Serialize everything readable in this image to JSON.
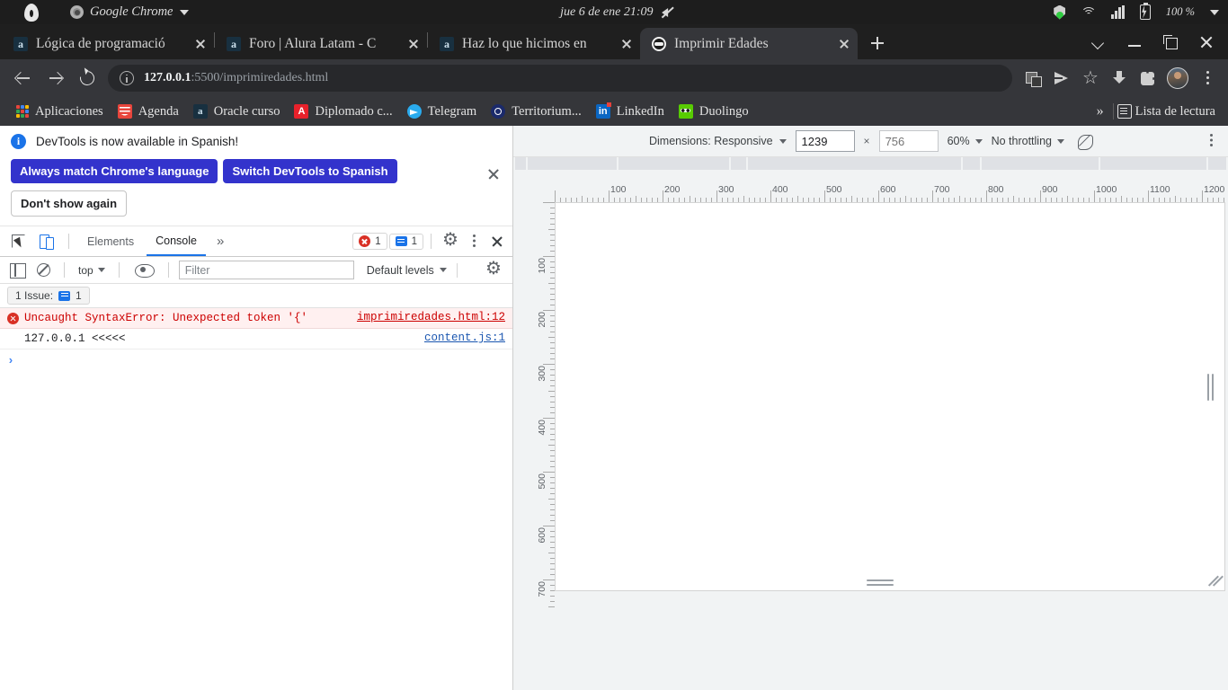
{
  "os_bar": {
    "app_menu": "Google Chrome",
    "clock": "jue  6 de ene  21:09",
    "battery_pct": "100 %",
    "icons": [
      "alien-logo",
      "chrome-icon",
      "chevron-down-icon",
      "mute-icon",
      "shield-icon",
      "wifi-icon",
      "volume-icon",
      "battery-icon"
    ]
  },
  "tabs": [
    {
      "title": "Lógica de programació",
      "favicon": "alura-a-icon",
      "active": false
    },
    {
      "title": "Foro | Alura Latam - C",
      "favicon": "alura-a-icon",
      "active": false
    },
    {
      "title": "Haz lo que hicimos en",
      "favicon": "alura-a-icon",
      "active": false
    },
    {
      "title": "Imprimir Edades",
      "favicon": "globe-icon",
      "active": true
    }
  ],
  "window_controls": {
    "chevron": "⌄",
    "minimize": "—",
    "maximize": "▭",
    "close": "✕"
  },
  "omnibox": {
    "url_host": "127.0.0.1",
    "url_rest": ":5500/imprimiredades.html",
    "icons": [
      "translate-icon",
      "send-icon",
      "star-icon",
      "download-icon",
      "puzzle-icon",
      "avatar",
      "kebab-icon"
    ]
  },
  "bookmarks": {
    "items": [
      {
        "label": "Aplicaciones",
        "icon": "apps-grid-icon"
      },
      {
        "label": "Agenda",
        "icon": "agenda-icon"
      },
      {
        "label": "Oracle curso",
        "icon": "alura-a-icon"
      },
      {
        "label": "Diplomado c...",
        "icon": "alura-red-icon"
      },
      {
        "label": "Telegram",
        "icon": "telegram-icon"
      },
      {
        "label": "Territorium...",
        "icon": "territorium-icon"
      },
      {
        "label": "LinkedIn",
        "icon": "linkedin-icon"
      },
      {
        "label": "Duolingo",
        "icon": "duolingo-icon"
      }
    ],
    "overflow": "»",
    "reading_list": "Lista de lectura"
  },
  "devtools": {
    "banner": {
      "title": "DevTools is now available in Spanish!",
      "primary_button": "Always match Chrome's language",
      "secondary_button": "Switch DevTools to Spanish",
      "tertiary_button": "Don't show again"
    },
    "tabs": [
      {
        "label": "Elements",
        "selected": false
      },
      {
        "label": "Console",
        "selected": true
      }
    ],
    "more_tabs": "»",
    "error_count": "1",
    "message_count": "1",
    "console_toolbar": {
      "context": "top",
      "filter_placeholder": "Filter",
      "levels": "Default levels"
    },
    "issue_bar": {
      "label": "1 Issue:",
      "count": "1"
    },
    "logs": [
      {
        "type": "error",
        "message": "Uncaught SyntaxError: Unexpected token '{'",
        "source": "imprimiredades.html:12"
      },
      {
        "type": "log",
        "message": "127.0.0.1 <<<<<",
        "source": "content.js:1"
      }
    ],
    "prompt_caret": "›"
  },
  "emulation": {
    "dimensions_label": "Dimensions: Responsive",
    "width_value": "1239",
    "height_placeholder": "756",
    "multiply": "×",
    "zoom": "60%",
    "throttling": "No throttling",
    "rotate_icon": "rotate-icon",
    "kebab_icon": "kebab-icon",
    "h_ruler_labels": [
      "100",
      "200",
      "300",
      "400",
      "500",
      "600",
      "700",
      "800",
      "900",
      "1000",
      "1100",
      "1200"
    ],
    "v_ruler_labels": [
      "100",
      "200",
      "300",
      "400",
      "500",
      "600",
      "700"
    ]
  }
}
